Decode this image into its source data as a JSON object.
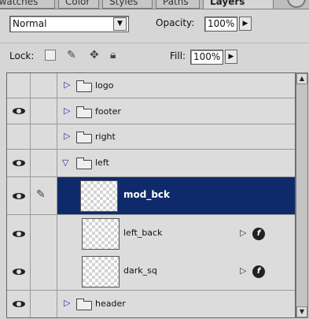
{
  "tabs": [
    {
      "label": "Swatches"
    },
    {
      "label": "Color"
    },
    {
      "label": "Styles"
    },
    {
      "label": "Paths"
    },
    {
      "label": "Layers",
      "active": true
    }
  ],
  "blend": {
    "value": "Normal"
  },
  "opacity": {
    "label": "Opacity:",
    "value": "100%"
  },
  "lock": {
    "label": "Lock:"
  },
  "fill": {
    "label": "Fill:",
    "value": "100%"
  },
  "layers": [
    {
      "name": "logo",
      "type": "folder",
      "visible": false,
      "expanded": false
    },
    {
      "name": "footer",
      "type": "folder",
      "visible": true,
      "expanded": false
    },
    {
      "name": "right",
      "type": "folder",
      "visible": false,
      "expanded": false
    },
    {
      "name": "left",
      "type": "folder",
      "visible": true,
      "expanded": true
    },
    {
      "name": "mod_bck",
      "type": "layer",
      "visible": true,
      "selected": true,
      "brush": true
    },
    {
      "name": "left_back",
      "type": "layer",
      "visible": true,
      "effects": true
    },
    {
      "name": "dark_sq",
      "type": "layer",
      "visible": true,
      "effects": true
    },
    {
      "name": "header",
      "type": "folder",
      "visible": true,
      "expanded": false
    }
  ],
  "colors": {
    "selection": "#0e2a6b",
    "row": "#dcdcdc",
    "panel": "#d6d6d6"
  }
}
